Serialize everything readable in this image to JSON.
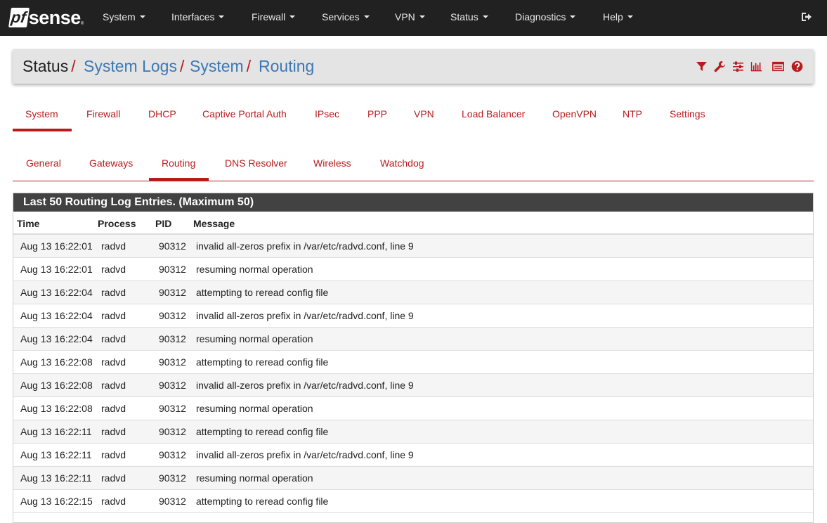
{
  "brand": {
    "pf": "pf",
    "sense": "sense",
    "tm": "®"
  },
  "navbar": {
    "items": [
      "System",
      "Interfaces",
      "Firewall",
      "Services",
      "VPN",
      "Status",
      "Diagnostics",
      "Help"
    ],
    "logout_icon": "sign-out-icon"
  },
  "breadcrumb": {
    "items": [
      "Status",
      "System Logs",
      "System",
      "Routing"
    ],
    "separator": "/",
    "icons": [
      "filter-icon",
      "wrench-icon",
      "sliders-icon",
      "bar-chart-icon",
      "list-icon",
      "help-icon"
    ]
  },
  "tabs_primary": {
    "items": [
      "System",
      "Firewall",
      "DHCP",
      "Captive Portal Auth",
      "IPsec",
      "PPP",
      "VPN",
      "Load Balancer",
      "OpenVPN",
      "NTP",
      "Settings"
    ],
    "active": "System"
  },
  "tabs_secondary": {
    "items": [
      "General",
      "Gateways",
      "Routing",
      "DNS Resolver",
      "Wireless",
      "Watchdog"
    ],
    "active": "Routing"
  },
  "log_panel": {
    "title": "Last 50 Routing Log Entries. (Maximum 50)",
    "columns": [
      "Time",
      "Process",
      "PID",
      "Message"
    ],
    "rows": [
      [
        "Aug 13 16:22:01",
        "radvd",
        "90312",
        "invalid all-zeros prefix in /var/etc/radvd.conf, line 9"
      ],
      [
        "Aug 13 16:22:01",
        "radvd",
        "90312",
        "resuming normal operation"
      ],
      [
        "Aug 13 16:22:04",
        "radvd",
        "90312",
        "attempting to reread config file"
      ],
      [
        "Aug 13 16:22:04",
        "radvd",
        "90312",
        "invalid all-zeros prefix in /var/etc/radvd.conf, line 9"
      ],
      [
        "Aug 13 16:22:04",
        "radvd",
        "90312",
        "resuming normal operation"
      ],
      [
        "Aug 13 16:22:08",
        "radvd",
        "90312",
        "attempting to reread config file"
      ],
      [
        "Aug 13 16:22:08",
        "radvd",
        "90312",
        "invalid all-zeros prefix in /var/etc/radvd.conf, line 9"
      ],
      [
        "Aug 13 16:22:08",
        "radvd",
        "90312",
        "resuming normal operation"
      ],
      [
        "Aug 13 16:22:11",
        "radvd",
        "90312",
        "attempting to reread config file"
      ],
      [
        "Aug 13 16:22:11",
        "radvd",
        "90312",
        "invalid all-zeros prefix in /var/etc/radvd.conf, line 9"
      ],
      [
        "Aug 13 16:22:11",
        "radvd",
        "90312",
        "resuming normal operation"
      ],
      [
        "Aug 13 16:22:15",
        "radvd",
        "90312",
        "attempting to reread config file"
      ]
    ]
  },
  "colors": {
    "navbar": "#212121",
    "accent": "#b71c1c",
    "link": "#3b78b5",
    "panel_header": "#424242"
  }
}
